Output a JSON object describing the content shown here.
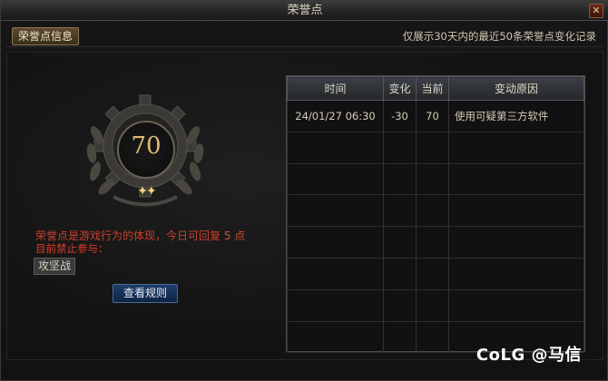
{
  "window": {
    "title": "荣誉点",
    "close_label": "✕"
  },
  "tab": {
    "label": "荣誉点信息"
  },
  "note": "仅展示30天内的最近50条荣誉点变化记录",
  "score": {
    "value": "70",
    "stars": "✦✦"
  },
  "info": {
    "text": "荣誉点是游戏行为的体现，今日可回复",
    "points": " 5 点",
    "ban_label": "目前禁止参与：",
    "ban_item": "攻坚战"
  },
  "rules_button": "查看规则",
  "table": {
    "headers": [
      "时间",
      "变化",
      "当前",
      "变动原因"
    ],
    "rows": [
      [
        "24/01/27 06:30",
        "-30",
        "70",
        "使用可疑第三方软件"
      ],
      [
        "",
        "",
        "",
        ""
      ],
      [
        "",
        "",
        "",
        ""
      ],
      [
        "",
        "",
        "",
        ""
      ],
      [
        "",
        "",
        "",
        ""
      ],
      [
        "",
        "",
        "",
        ""
      ],
      [
        "",
        "",
        "",
        ""
      ],
      [
        "",
        "",
        "",
        ""
      ]
    ]
  },
  "watermark": "CoLG @马信",
  "colors": {
    "accent_gold": "#e2bd79",
    "warning_red": "#e23a26",
    "button_blue": "#1d3e6a"
  }
}
